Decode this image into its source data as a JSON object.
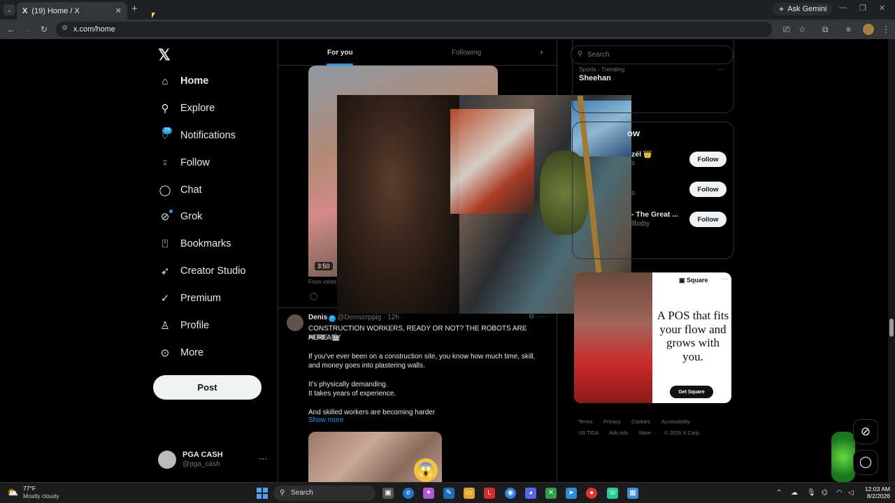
{
  "browser": {
    "tab_title": "(19) Home / X",
    "tab_favicon": "X",
    "url": "x.com/home",
    "gemini_label": "Ask Gemini"
  },
  "sidebar": {
    "logo": "𝕏",
    "items": [
      {
        "label": "Home",
        "icon": "home-icon",
        "glyph": "⌂"
      },
      {
        "label": "Explore",
        "icon": "search-icon",
        "glyph": "⚲"
      },
      {
        "label": "Notifications",
        "icon": "bell-icon",
        "glyph": "🔔"
      },
      {
        "label": "Follow",
        "icon": "person-add-icon",
        "glyph": "👤"
      },
      {
        "label": "Chat",
        "icon": "chat-icon",
        "glyph": "◯"
      },
      {
        "label": "Grok",
        "icon": "grok-icon",
        "glyph": "⊘"
      },
      {
        "label": "Bookmarks",
        "icon": "bookmark-icon",
        "glyph": "🔖"
      },
      {
        "label": "Creator Studio",
        "icon": "rocket-icon",
        "glyph": "➶"
      },
      {
        "label": "Premium",
        "icon": "verified-icon",
        "glyph": "✓"
      },
      {
        "label": "Profile",
        "icon": "profile-icon",
        "glyph": "👤"
      },
      {
        "label": "More",
        "icon": "more-icon",
        "glyph": "⋯"
      }
    ],
    "notifications_badge": "19",
    "post_label": "Post",
    "account": {
      "name": "PGA CASH",
      "handle": "@pga_cash"
    }
  },
  "timeline": {
    "tabs": [
      "For you",
      "Following"
    ],
    "video": {
      "duration": "3:50",
      "from": "From vshre"
    },
    "tweet": {
      "name": "Denis",
      "handle": "@Deniscrppig",
      "time": "· 12h",
      "line1": "CONSTRUCTION WORKERS, READY OR NOT? THE ROBOTS ARE ALREADY",
      "line2": "HERE. 🤖",
      "p1a": "If you've ever been on a construction site, you know how much time, skill,",
      "p1b": "and money goes into plastering walls.",
      "p2a": "It's physically demanding.",
      "p2b": "It takes years of experience.",
      "p3": "And skilled workers are becoming harder",
      "show_more": "Show more"
    }
  },
  "right": {
    "search_placeholder": "Search",
    "trend": {
      "category": "Sports · Trending",
      "name": "Sheehan"
    },
    "top_trend_category": "Sports · Trending",
    "follow_title": "ow",
    "follow": [
      {
        "name": "zél 👑",
        "handle": "s",
        "button": "Follow"
      },
      {
        "name": "",
        "handle": "s",
        "button": "Follow"
      },
      {
        "name": "- The Great ...",
        "handle": "llbaby",
        "button": "Follow"
      }
    ],
    "ad": {
      "brand": "Square",
      "headline": "A POS that fits your flow and grows with you.",
      "cta": "Get Square"
    },
    "footer": {
      "terms": "Terms",
      "privacy": "Privacy",
      "cookies": "Cookies",
      "accessibility": "Accessibility",
      "ustida": "US TIDA",
      "adsinfo": "Ads info",
      "more": "More ···",
      "copyright": "© 2026 X Corp."
    }
  },
  "taskbar": {
    "temp": "77°F",
    "weather": "Mostly cloudy",
    "search": "Search",
    "time": "12:03 AM",
    "date": "8/2/2026"
  }
}
